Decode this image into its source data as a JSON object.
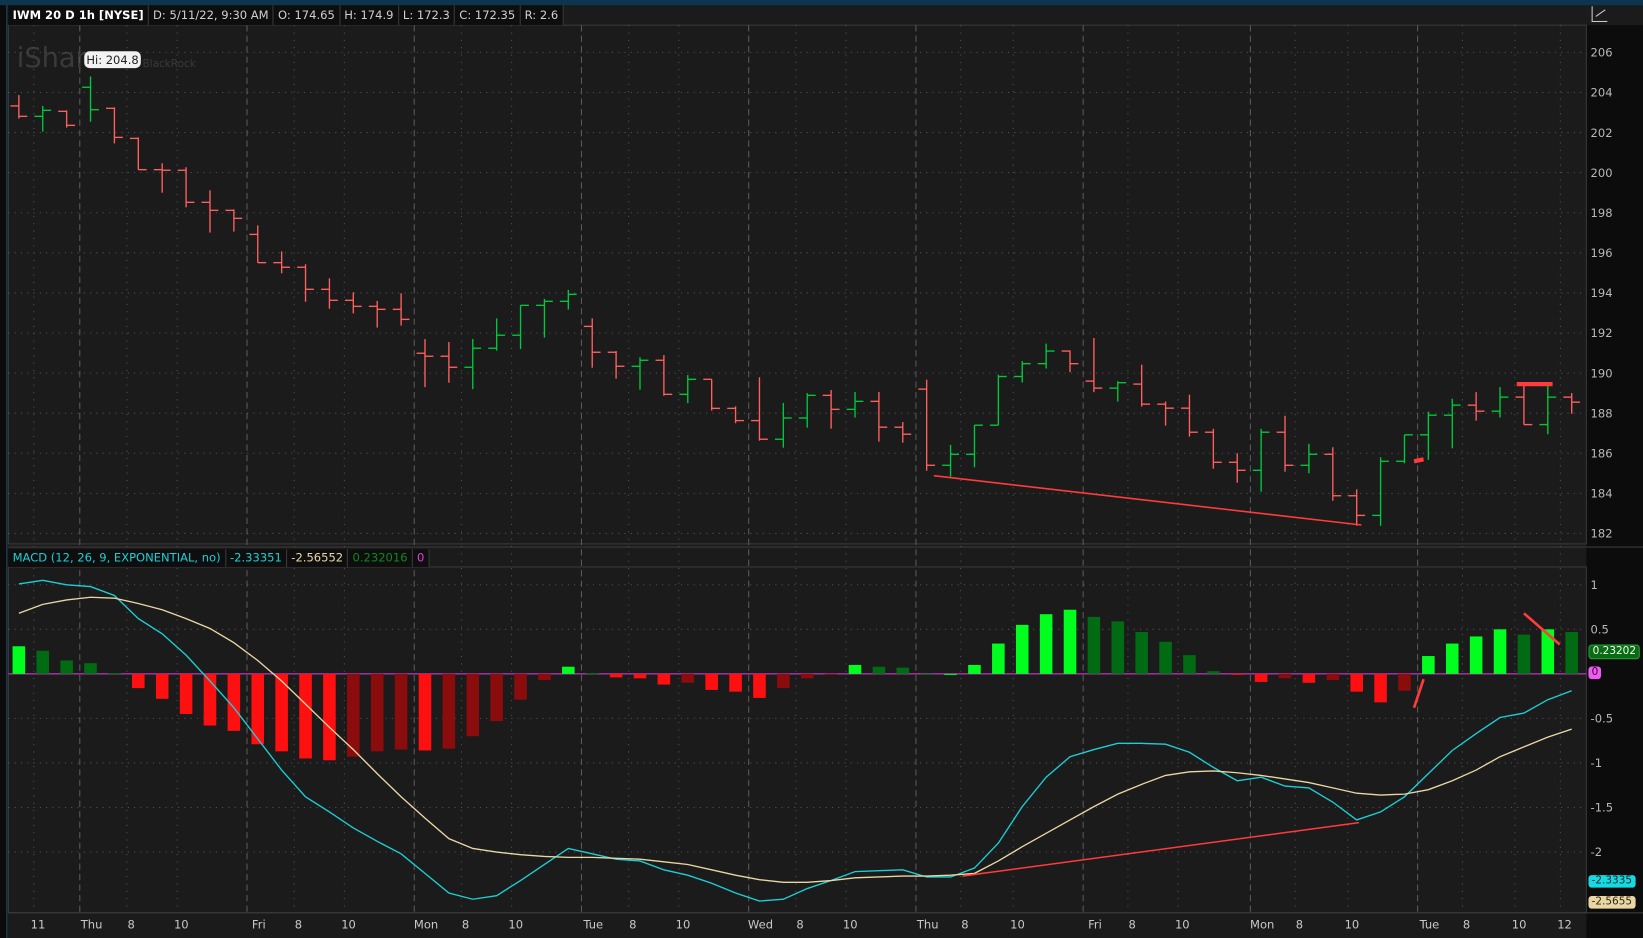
{
  "header": {
    "symbol": "IWM 20 D 1h [NYSE]",
    "date": "D: 5/11/22, 9:30 AM",
    "open": "O: 174.65",
    "high": "H: 174.9",
    "low": "L: 172.3",
    "close": "C: 172.35",
    "range": "R: 2.6"
  },
  "watermark": {
    "left": "iShares",
    "right": "BlackRock"
  },
  "tooltip": {
    "text": "Hi: 204.8",
    "bar": 3
  },
  "macd_header": {
    "title": "MACD (12, 26, 9, EXPONENTIAL, no)",
    "value": "-2.33351",
    "avg": "-2.56552",
    "diff": "0.232016",
    "zero": "0"
  },
  "readouts": {
    "diff": "0.23202",
    "zero": "0",
    "value": "-2.3335",
    "avg": "-2.5655"
  },
  "colors": {
    "up": "#00c83a",
    "down": "#ff5f5f",
    "hist_up_strong": "#00ff1e",
    "hist_up_weak": "#006b12",
    "hist_down_strong": "#ff1010",
    "hist_down_weak": "#8a0c0c",
    "macd": "#1ccfd6",
    "signal": "#e8d6a4",
    "zero": "#e040e0",
    "annotation": "#ff3b3b"
  },
  "chart_data": [
    {
      "type": "ohlc",
      "title": "IWM 20 D 1h [NYSE]",
      "ylim": [
        182,
        206
      ],
      "yticks": [
        182,
        184,
        186,
        188,
        190,
        192,
        194,
        196,
        198,
        200,
        202,
        204,
        206
      ],
      "xticks": [
        {
          "label": "11",
          "bar": 0.8
        },
        {
          "label": "Thu",
          "bar": 3,
          "day": true
        },
        {
          "label": "8",
          "bar": 4.7
        },
        {
          "label": "10",
          "bar": 6.8
        },
        {
          "label": "Fri",
          "bar": 10,
          "day": true
        },
        {
          "label": "8",
          "bar": 11.7
        },
        {
          "label": "10",
          "bar": 13.8
        },
        {
          "label": "Mon",
          "bar": 17,
          "day": true
        },
        {
          "label": "8",
          "bar": 18.7
        },
        {
          "label": "10",
          "bar": 20.8
        },
        {
          "label": "Tue",
          "bar": 24,
          "day": true
        },
        {
          "label": "8",
          "bar": 25.7
        },
        {
          "label": "10",
          "bar": 27.8
        },
        {
          "label": "Wed",
          "bar": 31,
          "day": true
        },
        {
          "label": "8",
          "bar": 32.7
        },
        {
          "label": "10",
          "bar": 34.8
        },
        {
          "label": "Thu",
          "bar": 38,
          "day": true
        },
        {
          "label": "8",
          "bar": 39.6
        },
        {
          "label": "10",
          "bar": 41.8
        },
        {
          "label": "Fri",
          "bar": 45,
          "day": true
        },
        {
          "label": "8",
          "bar": 46.6
        },
        {
          "label": "10",
          "bar": 48.7
        },
        {
          "label": "Mon",
          "bar": 52,
          "day": true
        },
        {
          "label": "8",
          "bar": 53.6
        },
        {
          "label": "10",
          "bar": 55.8
        },
        {
          "label": "Tue",
          "bar": 59,
          "day": true
        },
        {
          "label": "8",
          "bar": 60.6
        },
        {
          "label": "10",
          "bar": 62.8
        },
        {
          "label": "12",
          "bar": 64.7
        }
      ],
      "bars": [
        [
          203.33,
          203.87,
          202.7,
          202.81
        ],
        [
          202.81,
          203.33,
          202.05,
          203.11
        ],
        [
          203.06,
          203.11,
          202.25,
          202.36
        ],
        [
          204.26,
          204.8,
          202.54,
          203.14
        ],
        [
          203.21,
          203.26,
          201.46,
          201.76
        ],
        [
          201.71,
          201.76,
          200.15,
          200.15
        ],
        [
          200.15,
          200.47,
          199.0,
          200.12
        ],
        [
          200.12,
          200.27,
          198.27,
          198.52
        ],
        [
          198.52,
          199.12,
          197.01,
          198.12
        ],
        [
          198.12,
          198.17,
          197.06,
          197.72
        ],
        [
          196.92,
          197.37,
          195.51,
          195.51
        ],
        [
          195.51,
          196.07,
          194.98,
          195.28
        ],
        [
          195.28,
          195.43,
          193.56,
          194.18
        ],
        [
          194.18,
          194.73,
          193.21,
          193.63
        ],
        [
          193.63,
          194.03,
          192.98,
          193.33
        ],
        [
          193.33,
          193.6,
          192.27,
          193.18
        ],
        [
          193.18,
          193.98,
          192.37,
          192.68
        ],
        [
          190.99,
          191.7,
          189.3,
          190.84
        ],
        [
          190.84,
          191.55,
          189.52,
          190.29
        ],
        [
          190.29,
          191.7,
          189.2,
          191.24
        ],
        [
          191.24,
          192.73,
          191.12,
          191.89
        ],
        [
          191.89,
          193.38,
          191.2,
          193.38
        ],
        [
          193.38,
          193.7,
          191.77,
          193.58
        ],
        [
          193.58,
          194.15,
          193.17,
          193.93
        ],
        [
          192.33,
          192.73,
          190.27,
          191.04
        ],
        [
          191.04,
          191.1,
          189.72,
          190.34
        ],
        [
          190.34,
          190.79,
          189.17,
          190.64
        ],
        [
          190.64,
          190.9,
          188.87,
          188.94
        ],
        [
          188.94,
          189.9,
          188.5,
          189.69
        ],
        [
          189.69,
          189.69,
          188.13,
          188.24
        ],
        [
          188.24,
          188.34,
          187.5,
          187.63
        ],
        [
          187.63,
          189.79,
          186.63,
          186.7
        ],
        [
          186.7,
          188.51,
          186.28,
          187.76
        ],
        [
          187.76,
          189.0,
          187.28,
          188.89
        ],
        [
          188.89,
          189.16,
          187.23,
          188.19
        ],
        [
          188.19,
          189.06,
          187.78,
          188.59
        ],
        [
          188.59,
          189.06,
          186.58,
          187.3
        ],
        [
          187.3,
          187.56,
          186.53,
          186.95
        ],
        [
          189.2,
          189.67,
          185.13,
          185.4
        ],
        [
          185.4,
          186.42,
          184.83,
          185.95
        ],
        [
          185.95,
          187.4,
          185.3,
          187.4
        ],
        [
          187.4,
          189.92,
          187.4,
          189.83
        ],
        [
          189.83,
          190.6,
          189.53,
          190.47
        ],
        [
          190.47,
          191.47,
          190.23,
          191.1
        ],
        [
          191.1,
          191.13,
          190.05,
          190.47
        ],
        [
          189.6,
          191.75,
          189.05,
          189.25
        ],
        [
          189.25,
          189.6,
          188.58,
          189.52
        ],
        [
          189.45,
          190.42,
          188.33,
          188.45
        ],
        [
          188.45,
          188.58,
          187.38,
          188.25
        ],
        [
          188.25,
          188.92,
          186.83,
          187.05
        ],
        [
          187.05,
          187.22,
          185.23,
          185.55
        ],
        [
          185.55,
          186.0,
          184.53,
          185.15
        ],
        [
          185.15,
          187.22,
          184.08,
          187.05
        ],
        [
          187.05,
          187.87,
          185.08,
          185.4
        ],
        [
          185.4,
          186.47,
          185.0,
          185.95
        ],
        [
          185.95,
          186.3,
          183.63,
          183.88
        ],
        [
          183.88,
          184.2,
          182.38,
          182.9
        ],
        [
          182.9,
          185.8,
          182.38,
          185.6
        ],
        [
          185.6,
          186.92,
          185.5,
          186.92
        ],
        [
          186.92,
          188.07,
          185.67,
          187.9
        ],
        [
          187.9,
          188.72,
          186.25,
          188.4
        ],
        [
          188.4,
          189.05,
          187.63,
          188.1
        ],
        [
          188.1,
          189.3,
          187.78,
          188.8
        ],
        [
          188.8,
          189.53,
          187.43,
          187.43
        ],
        [
          187.43,
          189.45,
          186.95,
          188.8
        ],
        [
          188.8,
          189.0,
          187.97,
          188.55
        ]
      ],
      "annotations": [
        {
          "type": "line",
          "from": [
            38.3,
            184.88
          ],
          "to": [
            56.2,
            182.42
          ]
        },
        {
          "type": "line",
          "from": [
            58.4,
            185.6
          ],
          "to": [
            58.8,
            185.7
          ]
        },
        {
          "type": "hline",
          "from": [
            62.7,
            189.45
          ],
          "to": [
            64.2,
            189.45
          ]
        }
      ]
    },
    {
      "type": "macd",
      "title": "MACD (12, 26, 9, EXPONENTIAL, no)",
      "ylim": [
        -2.65,
        1.0
      ],
      "yticks": [
        1,
        0.5,
        -0.5,
        -1,
        -1.5,
        -2
      ],
      "series": [
        {
          "name": "Value",
          "values": [
            1.01,
            1.05,
            1.0,
            0.98,
            0.88,
            0.62,
            0.45,
            0.21,
            -0.08,
            -0.38,
            -0.73,
            -1.08,
            -1.38,
            -1.55,
            -1.73,
            -1.88,
            -2.02,
            -2.24,
            -2.46,
            -2.53,
            -2.49,
            -2.32,
            -2.14,
            -1.96,
            -2.02,
            -2.08,
            -2.1,
            -2.2,
            -2.26,
            -2.35,
            -2.46,
            -2.55,
            -2.53,
            -2.41,
            -2.32,
            -2.22,
            -2.21,
            -2.2,
            -2.28,
            -2.28,
            -2.18,
            -1.9,
            -1.49,
            -1.16,
            -0.93,
            -0.85,
            -0.78,
            -0.78,
            -0.79,
            -0.88,
            -1.05,
            -1.2,
            -1.16,
            -1.26,
            -1.28,
            -1.44,
            -1.64,
            -1.55,
            -1.38,
            -1.12,
            -0.86,
            -0.67,
            -0.49,
            -0.44,
            -0.29,
            -0.19
          ]
        },
        {
          "name": "Avg",
          "values": [
            0.68,
            0.78,
            0.83,
            0.86,
            0.85,
            0.79,
            0.72,
            0.62,
            0.51,
            0.35,
            0.15,
            -0.08,
            -0.34,
            -0.6,
            -0.85,
            -1.12,
            -1.38,
            -1.62,
            -1.85,
            -1.96,
            -2.0,
            -2.03,
            -2.05,
            -2.06,
            -2.06,
            -2.07,
            -2.08,
            -2.11,
            -2.14,
            -2.2,
            -2.26,
            -2.31,
            -2.34,
            -2.34,
            -2.32,
            -2.29,
            -2.28,
            -2.27,
            -2.27,
            -2.26,
            -2.24,
            -2.1,
            -1.94,
            -1.79,
            -1.64,
            -1.49,
            -1.35,
            -1.24,
            -1.14,
            -1.1,
            -1.09,
            -1.11,
            -1.14,
            -1.18,
            -1.22,
            -1.28,
            -1.34,
            -1.36,
            -1.35,
            -1.3,
            -1.2,
            -1.08,
            -0.93,
            -0.82,
            -0.71,
            -0.62
          ]
        },
        {
          "name": "Diff",
          "values": [
            0.31,
            0.26,
            0.15,
            0.12,
            0.01,
            -0.16,
            -0.28,
            -0.45,
            -0.58,
            -0.64,
            -0.79,
            -0.87,
            -0.95,
            -0.97,
            -0.93,
            -0.87,
            -0.85,
            -0.86,
            -0.84,
            -0.7,
            -0.53,
            -0.29,
            -0.07,
            0.08,
            0.01,
            -0.04,
            -0.05,
            -0.12,
            -0.1,
            -0.18,
            -0.2,
            -0.27,
            -0.16,
            -0.05,
            -0.01,
            0.1,
            0.08,
            0.07,
            0.0,
            0.0,
            0.1,
            0.34,
            0.55,
            0.67,
            0.72,
            0.64,
            0.59,
            0.47,
            0.36,
            0.21,
            0.03,
            -0.01,
            -0.09,
            -0.05,
            -0.1,
            -0.07,
            -0.2,
            -0.32,
            -0.19,
            0.2,
            0.34,
            0.42,
            0.5,
            0.44,
            0.5,
            0.47
          ]
        }
      ],
      "annotations": [
        {
          "type": "line",
          "from": [
            39.5,
            -2.27
          ],
          "to": [
            56.1,
            -1.67
          ]
        },
        {
          "type": "line",
          "from": [
            58.4,
            -0.38
          ],
          "to": [
            58.8,
            -0.06
          ]
        },
        {
          "type": "line",
          "from": [
            63.0,
            0.68
          ],
          "to": [
            64.5,
            0.33
          ]
        }
      ]
    }
  ]
}
